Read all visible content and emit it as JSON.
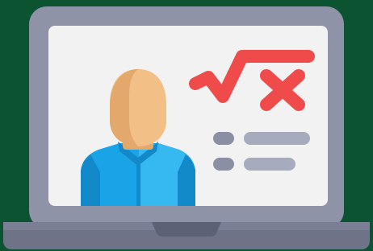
{
  "illustration": {
    "icon": "laptop-online-math-lesson-icon",
    "formula_glyph": "√x",
    "colors": {
      "background": "#0b5331",
      "laptop_body": "#8f93a8",
      "laptop_body_shadow": "#7b7f95",
      "screen": "#f2f2f2",
      "base": "#6f7388",
      "base_notch": "#5d6175",
      "skin": "#f2bf86",
      "skin_shadow": "#e3a96c",
      "shirt": "#1aa3e6",
      "shirt_light": "#36b8f0",
      "shirt_dark": "#1289c8",
      "formula": "#ef4b4b",
      "bullet": "#8a8fa3",
      "line": "#a6abbd"
    }
  }
}
